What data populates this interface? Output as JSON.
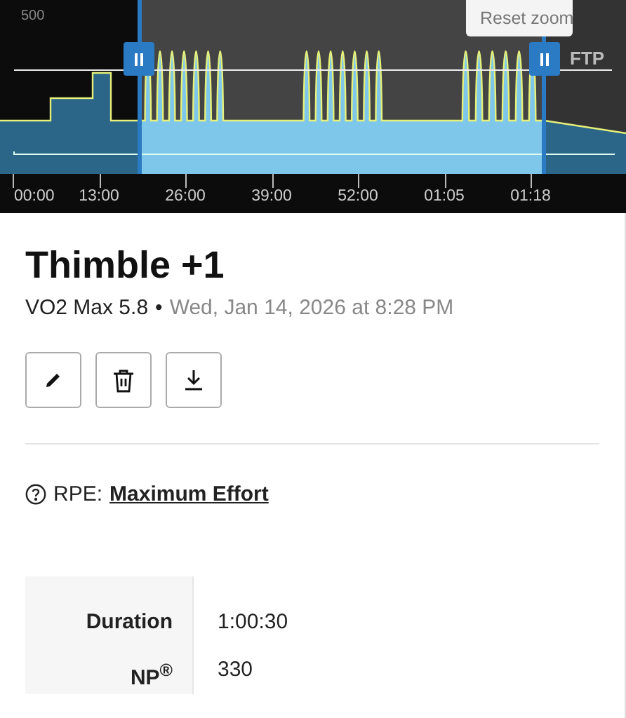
{
  "chart": {
    "y_label": "500",
    "ftp_label": "FTP",
    "reset_zoom": "Reset zoom",
    "x_ticks": [
      "00:00",
      "13:00",
      "26:00",
      "39:00",
      "52:00",
      "01:05",
      "01:18"
    ]
  },
  "workout": {
    "title": "Thimble +1",
    "type": "VO2 Max 5.8",
    "separator": "•",
    "date": "Wed, Jan 14, 2026 at 8:28 PM"
  },
  "rpe": {
    "label": "RPE:",
    "value": "Maximum Effort"
  },
  "stats": [
    {
      "label": "Duration",
      "value": "1:00:30"
    },
    {
      "label": "NP$^{®}$",
      "value": "330"
    }
  ]
}
